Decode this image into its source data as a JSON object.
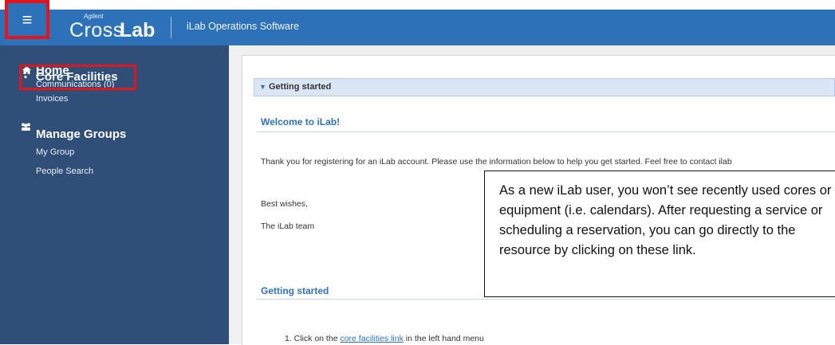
{
  "header": {
    "brand_small": "Agilent",
    "brand_cross": "Cross",
    "brand_lab": "Lab",
    "app_title": "iLab Operations Software",
    "menu_glyph": "≡"
  },
  "sidebar": {
    "home": {
      "label": "Home",
      "icon": "home-icon",
      "sub": [
        "Communications (0)"
      ]
    },
    "core": {
      "label": "Core Facilities",
      "icon": "core-facilities-icon",
      "sub": [
        "Invoices"
      ]
    },
    "groups": {
      "label": "Manage Groups",
      "icon": "groups-icon",
      "sub": [
        "My Group",
        "People Search"
      ]
    }
  },
  "panel": {
    "header": "Getting started",
    "welcome_title": "Welcome to iLab!",
    "intro": "Thank you for registering for an iLab account. Please use the information below to help you get started. Feel free to contact ilab",
    "regards": "Best wishes,",
    "signoff": "The iLab team",
    "getting_started_title": "Getting started",
    "step1_prefix": "1. Click on the",
    "step1_link": "core facilities link",
    "step1_suffix": "in the left hand menu"
  },
  "callout": {
    "text": "As a new iLab user, you won’t see recently used cores or equipment (i.e. calendars). After requesting a service or scheduling a reservation, you can go directly to the resource by clicking on these link."
  },
  "colors": {
    "header_blue": "#2d72b8",
    "sidebar_navy": "#2f4f79",
    "highlight_red": "#e3151a",
    "link_blue": "#2d72b8"
  }
}
